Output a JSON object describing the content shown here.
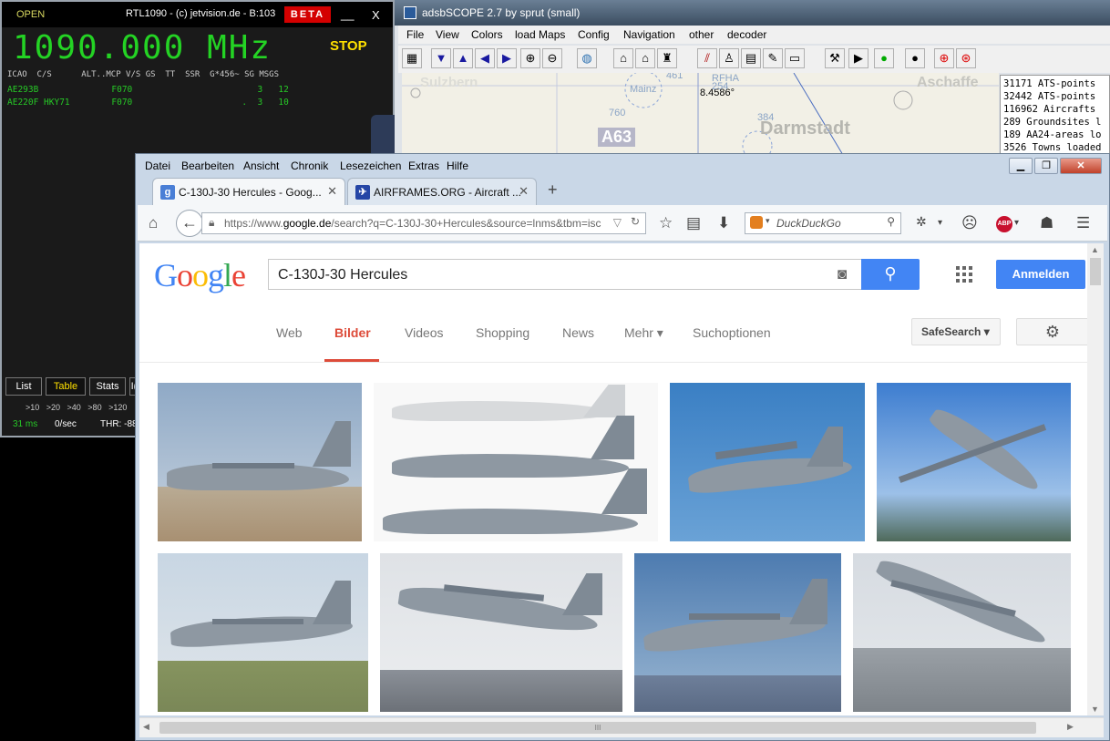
{
  "rtl1090": {
    "status": "OPEN",
    "title": "RTL1090 - (c) jetvision.de - B:103",
    "beta": "BETA",
    "minimize": "__",
    "close": "X",
    "frequency": "1090.000 MHz",
    "stop": "STOP",
    "table_header": "ICAO  C/S      ALT..MCP V/S GS  TT  SSR  G*456~ SG MSGS",
    "rows": [
      "AE293B              F070                        3   12",
      "AE220F HKY71        F070                     .  3   10"
    ],
    "tabs": [
      "List",
      "Table",
      "Stats",
      "I("
    ],
    "ranges": ">10   >20   >40   >80   >120",
    "stats": {
      "ms": "31 ms",
      "rate": "0/sec",
      "thr": "THR: -88"
    }
  },
  "adsbscope": {
    "title": "adsbSCOPE 2.7 by sprut  (small)",
    "menus": [
      "File",
      "View",
      "Colors",
      "load Maps",
      "Config",
      "Navigation",
      "other",
      "decoder"
    ],
    "map_labels": [
      "Mainz",
      "8.4586°",
      "760",
      "384",
      "Darmstadt",
      "A63",
      "Aschaffe",
      "Sulzbern",
      "RFHA",
      "254",
      "461"
    ],
    "log": [
      "31171 ATS-points",
      "32442 ATS-points",
      "116962 Aircrafts",
      "289 Groundsites l",
      "189 AA24-areas lo",
      "3526 Towns loaded"
    ]
  },
  "firefox": {
    "menus": [
      "Datei",
      "Bearbeiten",
      "Ansicht",
      "Chronik",
      "Lesezeichen",
      "Extras",
      "Hilfe"
    ],
    "tabs": [
      {
        "label": "C-130J-30 Hercules - Goog...",
        "icon": "g-favicon",
        "active": true
      },
      {
        "label": "AIRFRAMES.ORG - Aircraft ...",
        "icon": "airframes-favicon",
        "active": false
      }
    ],
    "new_tab": "+",
    "url_prefix": "https://www.",
    "url_host": "google.de",
    "url_rest": "/search?q=C-130J-30+Hercules&source=lnms&tbm=isc",
    "search_engine_placeholder": "DuckDuckGo",
    "abp": "ABP"
  },
  "google": {
    "logo": "Google",
    "query": "C-130J-30 Hercules",
    "signin": "Anmelden",
    "nav": [
      "Web",
      "Bilder",
      "Videos",
      "Shopping",
      "News",
      "Mehr ▾",
      "Suchoptionen"
    ],
    "active_nav": "Bilder",
    "safesearch": "SafeSearch ▾",
    "scroll_grip": "III",
    "colors": {
      "accent_blue": "#4285f4",
      "active_red": "#dd4b39"
    }
  }
}
